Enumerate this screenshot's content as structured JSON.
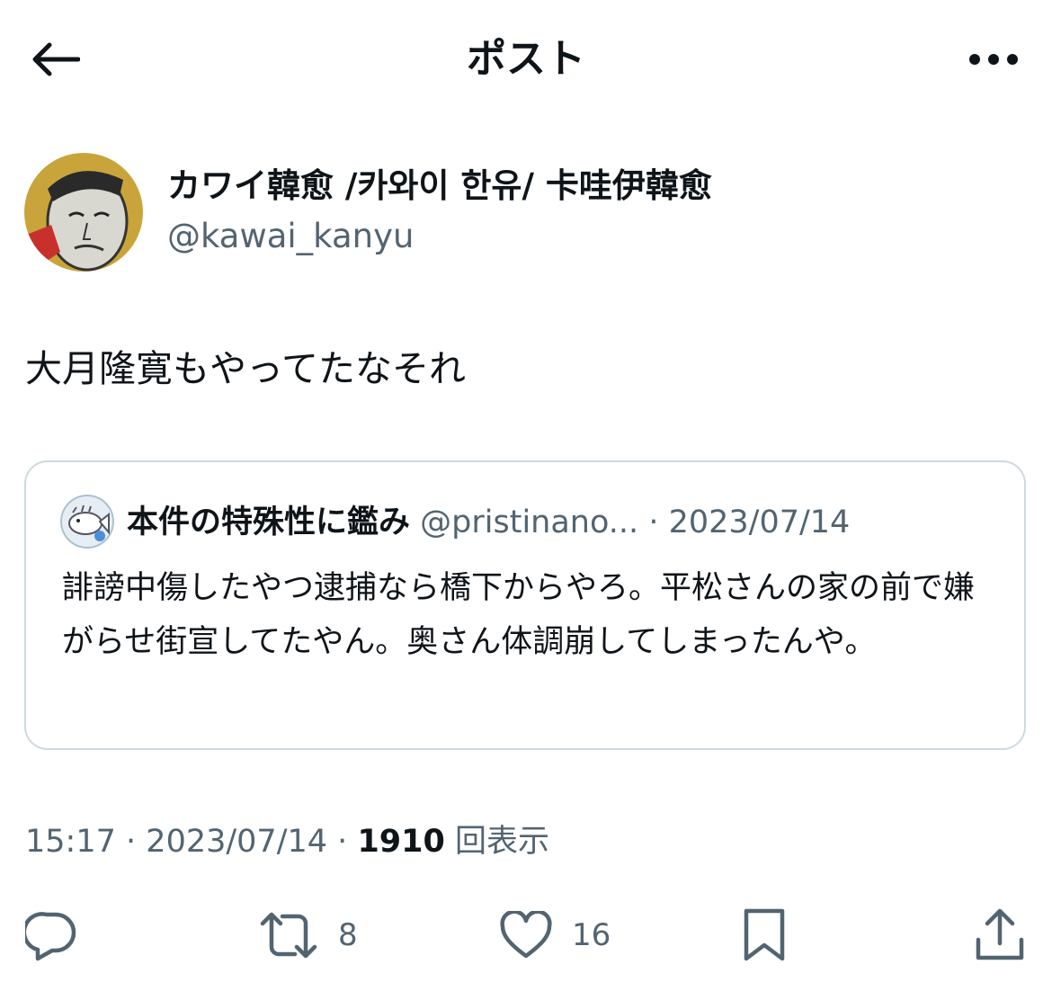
{
  "header": {
    "title": "ポスト",
    "back_icon": "arrow-left-icon",
    "more_icon": "more-dots-icon"
  },
  "author": {
    "name": "カワイ韓愈 /카와이 한유/ 卡哇伊韓愈",
    "handle": "@kawai_kanyu"
  },
  "post": {
    "text": "大月隆寛もやってたなそれ",
    "time": "15:17",
    "date": "2023/07/14",
    "views": "1910",
    "views_label": "回表示",
    "separator": "·"
  },
  "quote": {
    "name": "本件の特殊性に鑑み",
    "handle": "@pristinano...",
    "separator": "·",
    "date": "2023/07/14",
    "text": "誹謗中傷したやつ逮捕なら橋下からやろ。平松さんの家の前で嫌がらせ街宣してたやん。奥さん体調崩してしまったんや。"
  },
  "actions": {
    "reply_icon": "reply-icon",
    "repost_icon": "repost-icon",
    "repost_count": "8",
    "like_icon": "heart-icon",
    "like_count": "16",
    "bookmark_icon": "bookmark-icon",
    "share_icon": "share-icon"
  },
  "colors": {
    "text": "#0f1419",
    "secondary": "#536471",
    "border": "#cfd9de"
  }
}
